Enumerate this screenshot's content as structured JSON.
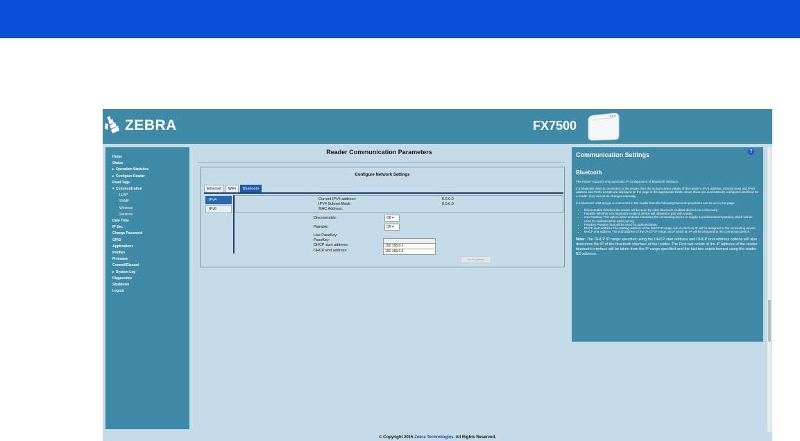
{
  "header": {
    "brand": "ZEBRA",
    "model": "FX7500"
  },
  "sidebar": {
    "items": [
      {
        "label": "Home",
        "level": 0,
        "arrow": ""
      },
      {
        "label": "Status",
        "level": 0,
        "arrow": ""
      },
      {
        "label": "Operation Statistics",
        "level": 0,
        "arrow": "▸"
      },
      {
        "label": "Configure Reader",
        "level": 0,
        "arrow": "▸"
      },
      {
        "label": "Read Tags",
        "level": 0,
        "arrow": ""
      },
      {
        "label": "Communication",
        "level": 0,
        "arrow": "▾"
      },
      {
        "label": "LLRP",
        "level": 1,
        "arrow": ""
      },
      {
        "label": "SNMP",
        "level": 1,
        "arrow": ""
      },
      {
        "label": "Wireless",
        "level": 1,
        "arrow": ""
      },
      {
        "label": "Services",
        "level": 1,
        "arrow": ""
      },
      {
        "label": "Date Time",
        "level": 0,
        "arrow": ""
      },
      {
        "label": "IP Sec",
        "level": 0,
        "arrow": ""
      },
      {
        "label": "Change Password",
        "level": 0,
        "arrow": ""
      },
      {
        "label": "GPIO",
        "level": 0,
        "arrow": ""
      },
      {
        "label": "Applications",
        "level": 0,
        "arrow": ""
      },
      {
        "label": "Profiles",
        "level": 0,
        "arrow": ""
      },
      {
        "label": "Firmware",
        "level": 0,
        "arrow": ""
      },
      {
        "label": "Commit/Discard",
        "level": 0,
        "arrow": ""
      },
      {
        "label": "System Log",
        "level": 0,
        "arrow": "▸"
      },
      {
        "label": "Diagnostics",
        "level": 0,
        "arrow": ""
      },
      {
        "label": "Shutdown",
        "level": 0,
        "arrow": ""
      },
      {
        "label": "Logout",
        "level": 0,
        "arrow": ""
      }
    ]
  },
  "main": {
    "title": "Reader Communication Parameters",
    "panel_title": "Configure Network Settings",
    "tabs": [
      "Ethernet",
      "WiFi",
      "Bluetooth"
    ],
    "subtabs": [
      "IPv4",
      "IPv6"
    ],
    "info": {
      "current_ipv4_label": "Current IPV4 address:",
      "current_ipv4_value": "0.0.0.0",
      "subnet_label": "IPV4 Subnet Mask:",
      "subnet_value": "0.0.0.0",
      "mac_label": "MAC Address:"
    },
    "form": {
      "discoverable_label": "Discoverable:",
      "discoverable_value": "Off ▾",
      "pairable_label": "Pairable:",
      "pairable_value": "Off ▾",
      "use_passkey_label": "Use PassKey:",
      "passkey_label": "PassKey:",
      "dhcp_start_label": "DHCP start address:",
      "dhcp_start_value": "192.168.0.2",
      "dhcp_end_label": "DHCP end address:",
      "dhcp_end_value": "192.168.0.3"
    },
    "set_button": "Set Properties"
  },
  "help": {
    "title": "Communication Settings",
    "subtitle": "Bluetooth",
    "p1": "The reader supports only automatic IP configuration of Bluetooth interface.",
    "p2": "If a bluetooth client is connected to the reader then the actual current values of the reader's IPV4 address, Subnet mask and IPV6 address and Prefix Length are displayed on the page in the appropriate fields. Since these are automatically configured and fixed for a reader, they cannot be changed manually.",
    "p3": "If a bluetooth USB dongle is connected to the reader then the following bluetooth properties can be set in this page",
    "list": [
      "Discoverable Whether the reader will be seen by other bluetooth enabled devices on a discovery.",
      "Pairable Whether any bluetooth enabled device will allowed to pair with reader.",
      "Use Passkey This option when enabled mandates the connecting device to supply a predetermined passkey which will be used for authentication while pairing.",
      "Passkey Passkey that will be used for authentication.",
      "DHCP start address The starting address of the DHCP IP range out of which an IP will be assigned to the connecting device.",
      "DHCP end address The end address of the DHCP IP range out of which an IP will be assigned to the connecting device."
    ],
    "note_label": "Note:",
    "note": "The DHCP IP range specified using the DHCP start address and DHCP end address options will also determine the IP of the bluetooth interface of the reader. The First two octets of the IP address of the reader bluetooth interface will be taken from the IP range specified and the last two octets formed using the reader BD address.",
    "help_icon": "?"
  },
  "footer": {
    "prefix": "© Copyright 2015 ",
    "link": "Zebra Technologies",
    "suffix": ". All Rights Reserved."
  },
  "colors": {
    "topbar": "#0a4fd6",
    "header": "#3f8aa6",
    "background": "#c5dce8"
  }
}
